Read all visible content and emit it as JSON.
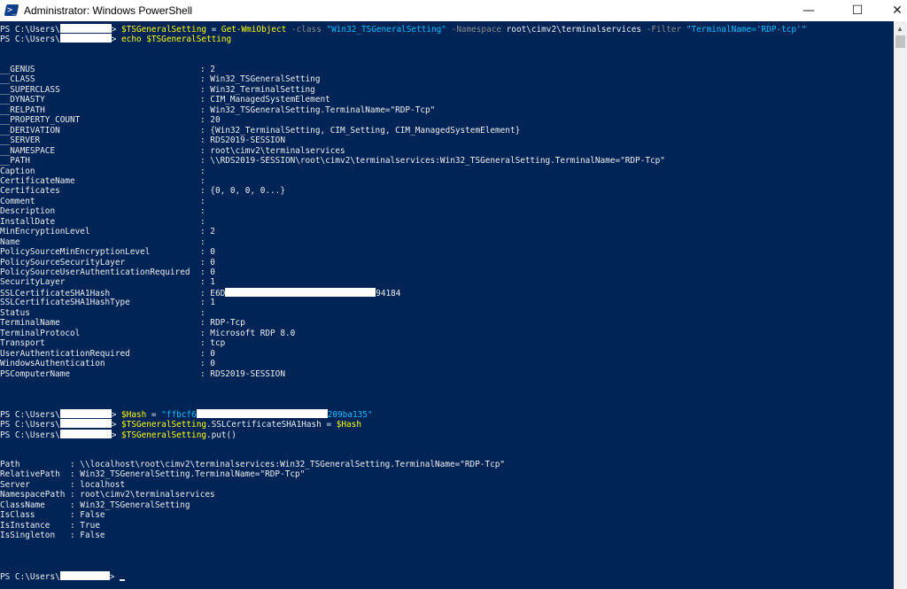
{
  "window": {
    "title": "Administrator: Windows PowerShell",
    "minimize_glyph": "—",
    "maximize_glyph": "☐",
    "close_glyph": "✕"
  },
  "app_icon": {
    "glyph": ">_"
  },
  "colors": {
    "console_bg": "#012456",
    "text": "#eeedf0",
    "cmdlet": "#ffff00",
    "string": "#00bfff",
    "param": "#8a8a8a"
  },
  "prompt": {
    "prefix": "PS C:\\Users\\",
    "suffix": "> "
  },
  "command1": {
    "var": "$TSGeneralSetting",
    "op": " = ",
    "cmdlet": "Get-WmiObject",
    "p_class": " -class ",
    "v_class": "\"Win32_TSGeneralSetting\"",
    "p_ns": " -Namespace ",
    "v_ns": "root\\cimv2\\terminalservices",
    "p_filter": " -Filter ",
    "v_filter": "\"TerminalName='RDP-tcp'\""
  },
  "command2": {
    "cmdlet": "echo",
    "arg": " $TSGeneralSetting"
  },
  "props": [
    {
      "k": "__GENUS",
      "v": "2"
    },
    {
      "k": "__CLASS",
      "v": "Win32_TSGeneralSetting"
    },
    {
      "k": "__SUPERCLASS",
      "v": "Win32_TerminalSetting"
    },
    {
      "k": "__DYNASTY",
      "v": "CIM_ManagedSystemElement"
    },
    {
      "k": "__RELPATH",
      "v": "Win32_TSGeneralSetting.TerminalName=\"RDP-Tcp\""
    },
    {
      "k": "__PROPERTY_COUNT",
      "v": "20"
    },
    {
      "k": "__DERIVATION",
      "v": "{Win32_TerminalSetting, CIM_Setting, CIM_ManagedSystemElement}"
    },
    {
      "k": "__SERVER",
      "v": "RDS2019-SESSION"
    },
    {
      "k": "__NAMESPACE",
      "v": "root\\cimv2\\terminalservices"
    },
    {
      "k": "__PATH",
      "v": "\\\\RDS2019-SESSION\\root\\cimv2\\terminalservices:Win32_TSGeneralSetting.TerminalName=\"RDP-Tcp\""
    },
    {
      "k": "Caption",
      "v": ""
    },
    {
      "k": "CertificateName",
      "v": ""
    },
    {
      "k": "Certificates",
      "v": "{0, 0, 0, 0...}"
    },
    {
      "k": "Comment",
      "v": ""
    },
    {
      "k": "Description",
      "v": ""
    },
    {
      "k": "InstallDate",
      "v": ""
    },
    {
      "k": "MinEncryptionLevel",
      "v": "2"
    },
    {
      "k": "Name",
      "v": ""
    },
    {
      "k": "PolicySourceMinEncryptionLevel",
      "v": "0"
    },
    {
      "k": "PolicySourceSecurityLayer",
      "v": "0"
    },
    {
      "k": "PolicySourceUserAuthenticationRequired",
      "v": "0"
    },
    {
      "k": "SecurityLayer",
      "v": "1"
    },
    {
      "k": "SSLCertificateSHA1Hash",
      "v": "E6D",
      "v_tail": "94184"
    },
    {
      "k": "SSLCertificateSHA1HashType",
      "v": "1"
    },
    {
      "k": "Status",
      "v": ""
    },
    {
      "k": "TerminalName",
      "v": "RDP-Tcp"
    },
    {
      "k": "TerminalProtocol",
      "v": "Microsoft RDP 8.0"
    },
    {
      "k": "Transport",
      "v": "tcp"
    },
    {
      "k": "UserAuthenticationRequired",
      "v": "0"
    },
    {
      "k": "WindowsAuthentication",
      "v": "0"
    },
    {
      "k": "PSComputerName",
      "v": "RDS2019-SESSION"
    }
  ],
  "command3": {
    "var": "$Hash",
    "op": " = ",
    "str_head": "\"ffbcf6",
    "str_tail": "209ba135\""
  },
  "command4": {
    "var": "$TSGeneralSetting",
    "prop": ".SSLCertificateSHA1Hash",
    "op": " = ",
    "rhs": "$Hash"
  },
  "command5": {
    "var": "$TSGeneralSetting",
    "call": ".put()"
  },
  "result": [
    {
      "k": "Path",
      "v": "\\\\localhost\\root\\cimv2\\terminalservices:Win32_TSGeneralSetting.TerminalName=\"RDP-Tcp\""
    },
    {
      "k": "RelativePath",
      "v": "Win32_TSGeneralSetting.TerminalName=\"RDP-Tcp\""
    },
    {
      "k": "Server",
      "v": "localhost"
    },
    {
      "k": "NamespacePath",
      "v": "root\\cimv2\\terminalservices"
    },
    {
      "k": "ClassName",
      "v": "Win32_TSGeneralSetting"
    },
    {
      "k": "IsClass",
      "v": "False"
    },
    {
      "k": "IsInstance",
      "v": "True"
    },
    {
      "k": "IsSingleton",
      "v": "False"
    }
  ]
}
